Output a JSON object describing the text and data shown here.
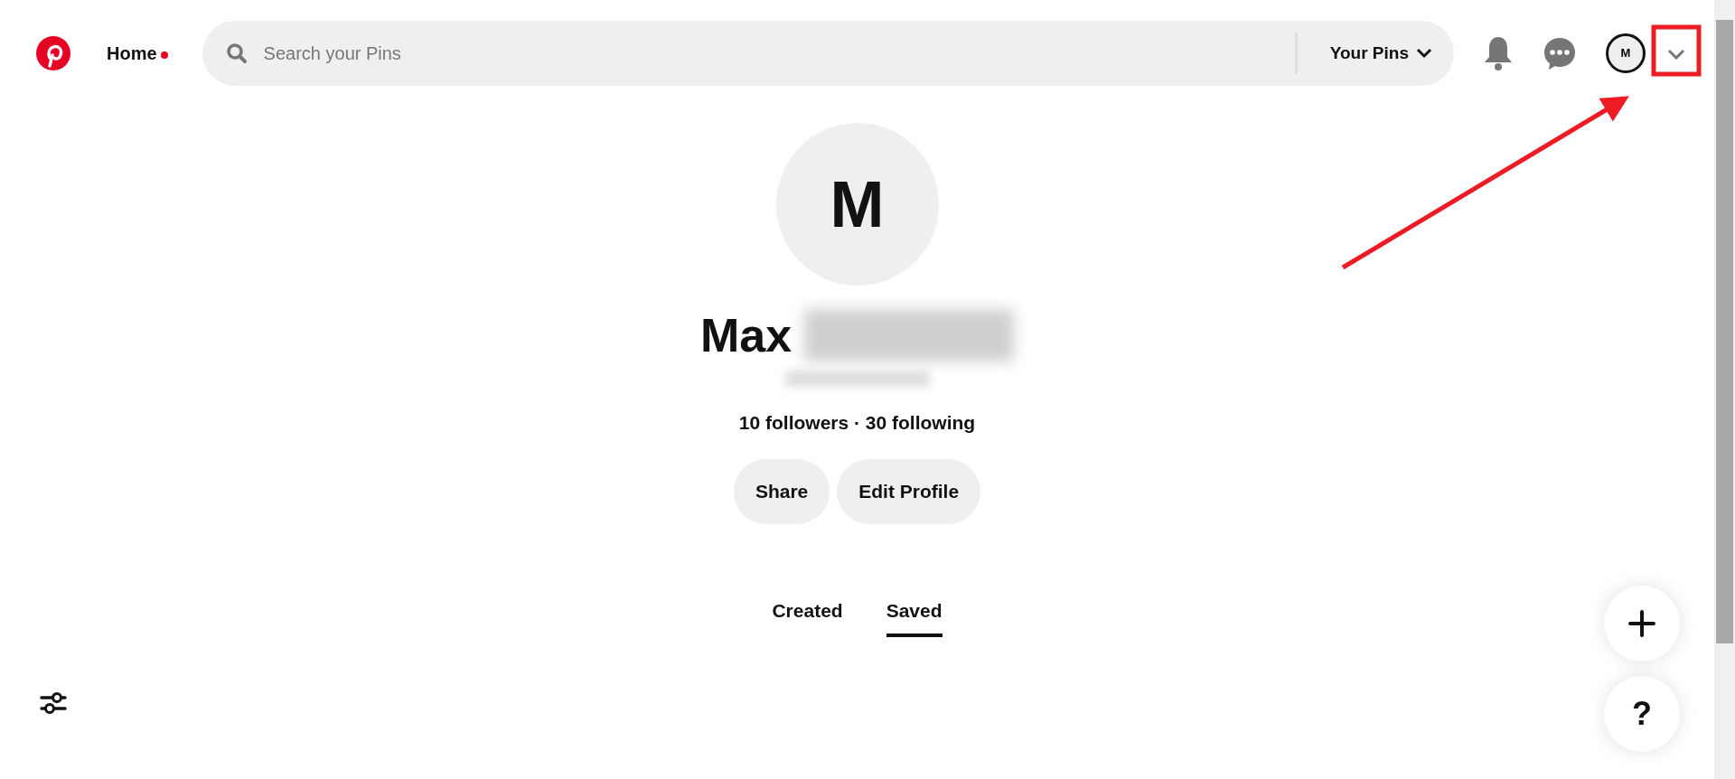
{
  "header": {
    "home": {
      "label": "Home",
      "unread": true
    },
    "search": {
      "placeholder": "Search your Pins"
    },
    "scope": {
      "label": "Your Pins"
    },
    "avatar": {
      "initial": "M"
    }
  },
  "profile": {
    "initial": "M",
    "first_name": "Max",
    "stats": "10 followers · 30 following",
    "buttons": [
      "Share",
      "Edit Profile"
    ]
  },
  "tabs": [
    {
      "label": "Created",
      "selected": false
    },
    {
      "label": "Saved",
      "selected": true
    }
  ],
  "fabs": [
    {
      "kind": "add"
    },
    {
      "kind": "help",
      "label": "?"
    }
  ]
}
